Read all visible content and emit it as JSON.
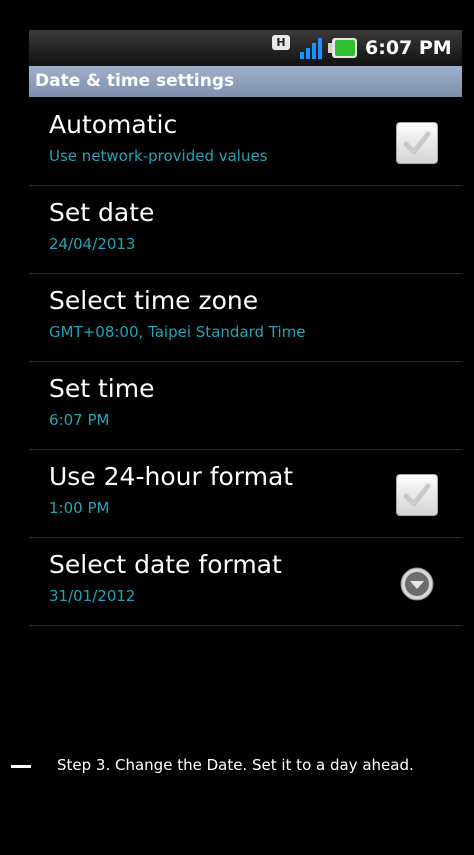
{
  "status_bar": {
    "network_badge": "H",
    "time": "6:07 PM",
    "colors": {
      "signal": "#1e90ff",
      "battery": "#2fbf2f"
    }
  },
  "title": "Date & time settings",
  "settings": [
    {
      "title": "Automatic",
      "subtitle": "Use network-provided values",
      "control": "checkbox"
    },
    {
      "title": "Set date",
      "subtitle": "24/04/2013",
      "control": "none"
    },
    {
      "title": "Select time zone",
      "subtitle": "GMT+08:00, Taipei Standard Time",
      "control": "none"
    },
    {
      "title": "Set time",
      "subtitle": "6:07 PM",
      "control": "none"
    },
    {
      "title": "Use 24-hour format",
      "subtitle": "1:00 PM",
      "control": "checkbox"
    },
    {
      "title": "Select date format",
      "subtitle": "31/01/2012",
      "control": "dropdown"
    }
  ],
  "footer": {
    "step_text": "Step 3. Change the Date. Set it to a day ahead."
  }
}
